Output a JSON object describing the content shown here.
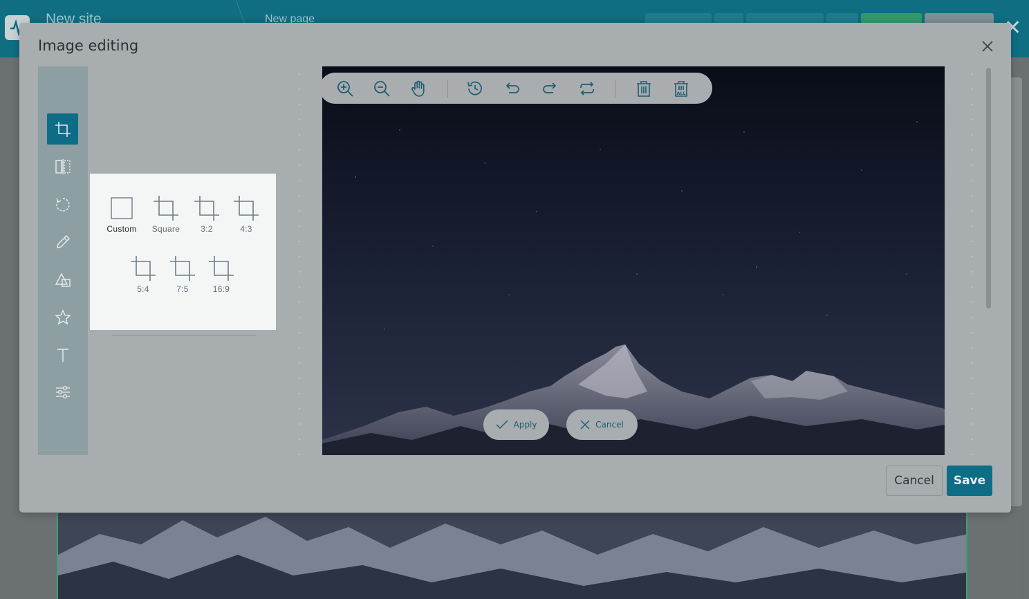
{
  "app": {
    "site_title": "New site",
    "page_title": "New page"
  },
  "modal": {
    "title": "Image editing",
    "close_icon": "close-icon"
  },
  "tools": [
    {
      "name": "crop",
      "icon": "crop-icon",
      "active": true
    },
    {
      "name": "flip",
      "icon": "flip-icon",
      "active": false
    },
    {
      "name": "rotate",
      "icon": "rotate-icon",
      "active": false
    },
    {
      "name": "draw",
      "icon": "pencil-icon",
      "active": false
    },
    {
      "name": "shape",
      "icon": "shape-icon",
      "active": false
    },
    {
      "name": "icon",
      "icon": "star-icon",
      "active": false
    },
    {
      "name": "text",
      "icon": "text-icon",
      "active": false
    },
    {
      "name": "filter",
      "icon": "sliders-icon",
      "active": false
    }
  ],
  "crop_presets": [
    {
      "label": "Custom",
      "selected": true
    },
    {
      "label": "Square",
      "selected": false
    },
    {
      "label": "3:2",
      "selected": false
    },
    {
      "label": "4:3",
      "selected": false
    },
    {
      "label": "5:4",
      "selected": false
    },
    {
      "label": "7:5",
      "selected": false
    },
    {
      "label": "16:9",
      "selected": false
    }
  ],
  "toolbar": [
    {
      "name": "zoom-in",
      "icon": "zoom-in-icon"
    },
    {
      "name": "zoom-out",
      "icon": "zoom-out-icon"
    },
    {
      "name": "hand",
      "icon": "hand-icon"
    },
    {
      "name": "history",
      "icon": "history-icon"
    },
    {
      "name": "undo",
      "icon": "undo-icon"
    },
    {
      "name": "redo",
      "icon": "redo-icon"
    },
    {
      "name": "reset",
      "icon": "reset-icon"
    },
    {
      "name": "delete",
      "icon": "trash-icon"
    },
    {
      "name": "delete-all",
      "icon": "trash-all-icon",
      "badge": "ALL"
    }
  ],
  "crop_actions": {
    "apply_label": "Apply",
    "cancel_label": "Cancel"
  },
  "footer": {
    "cancel_label": "Cancel",
    "save_label": "Save"
  },
  "colors": {
    "accent": "#0e6d86",
    "topbar": "#0f6e82",
    "overlay": "#a8adaf",
    "sky": "#0b0f1a"
  }
}
